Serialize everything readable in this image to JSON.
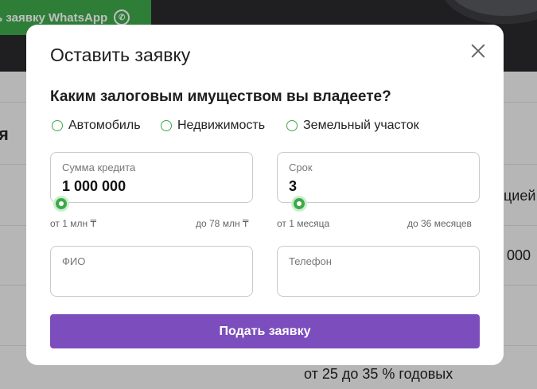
{
  "background": {
    "whatsapp_button": "ь заявку WhatsApp",
    "left_cut_text": "я",
    "right_cut_text_1": "цией",
    "right_cut_text_2": "000",
    "rate_text": "от 25 до 35 % годовых"
  },
  "modal": {
    "title": "Оставить заявку",
    "question": "Каким залоговым имуществом вы владеете?",
    "radio_options": [
      "Автомобиль",
      "Недвижимость",
      "Земельный участок"
    ],
    "amount": {
      "label": "Сумма кредита",
      "value": "1 000 000",
      "min_hint": "от 1 млн ₸",
      "max_hint": "до 78 млн ₸",
      "slider_fraction": 0
    },
    "term": {
      "label": "Срок",
      "value": "3",
      "min_hint": "от 1 месяца",
      "max_hint": "до 36 месяцев",
      "slider_fraction": 0
    },
    "name_field": {
      "placeholder": "ФИО"
    },
    "phone_field": {
      "placeholder": "Телефон"
    },
    "submit_label": "Подать заявку"
  },
  "colors": {
    "accent_green": "#3ea84b",
    "submit_purple": "#7c4ebd"
  }
}
